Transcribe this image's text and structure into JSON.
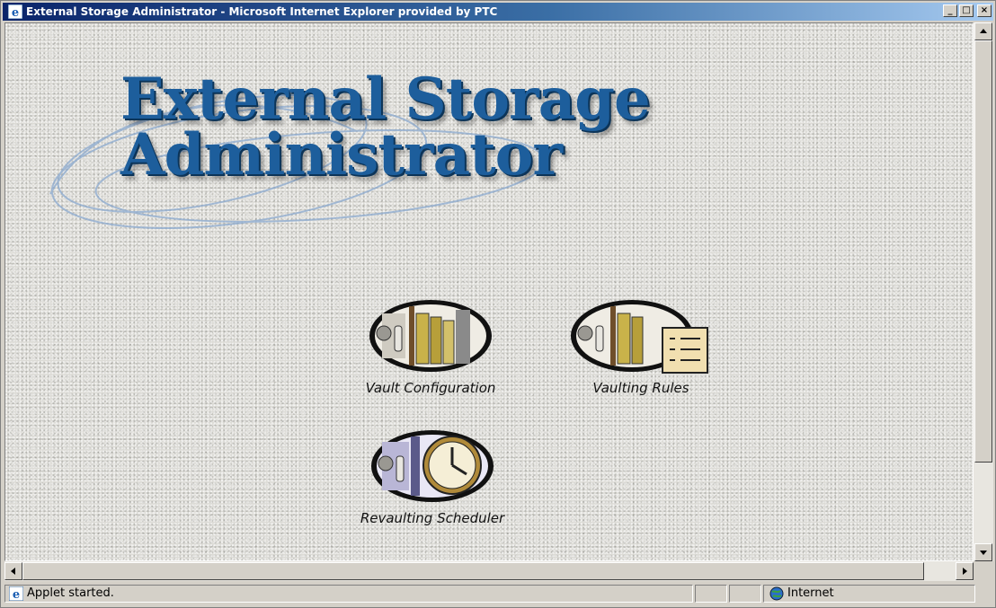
{
  "window": {
    "title": "External Storage Administrator - Microsoft Internet Explorer provided by PTC",
    "controls": {
      "minimize": "_",
      "maximize": "□",
      "close": "×"
    }
  },
  "page": {
    "heading_line1": "External Storage",
    "heading_line2": "Administrator",
    "tiles": [
      {
        "label": "Vault Configuration",
        "icon": "vault-folders-icon"
      },
      {
        "label": "Vaulting Rules",
        "icon": "vault-checklist-icon"
      },
      {
        "label": "Revaulting Scheduler",
        "icon": "vault-clock-icon"
      }
    ]
  },
  "status": {
    "message": "Applet started.",
    "zone": "Internet"
  },
  "colors": {
    "title_bar_start": "#0a246a",
    "heading_blue": "#1d5e9c"
  }
}
